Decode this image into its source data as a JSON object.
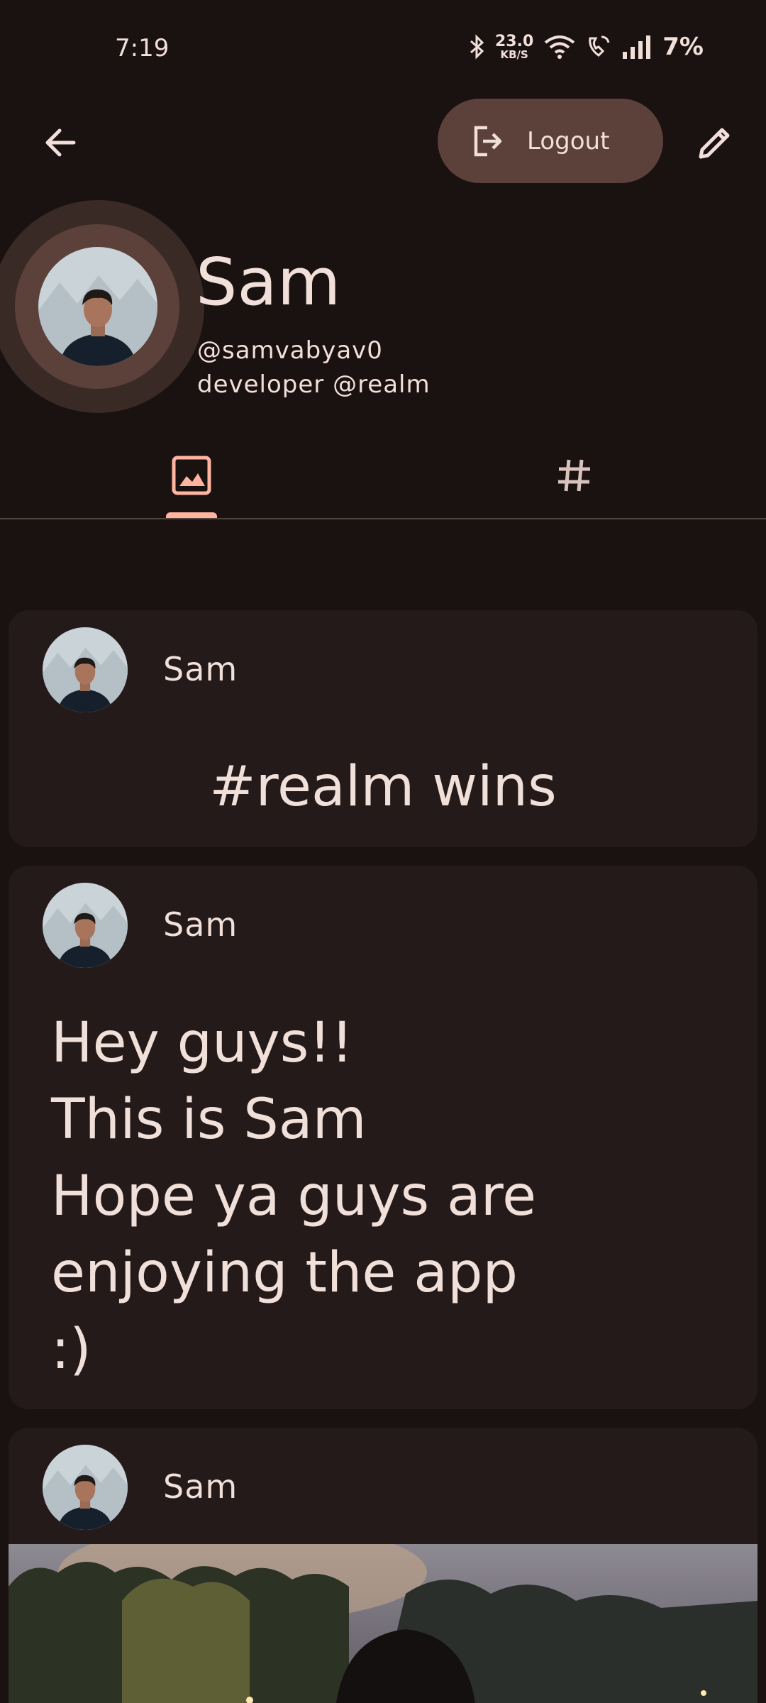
{
  "status_bar": {
    "time": "7:19",
    "net_speed_value": "23.0",
    "net_speed_unit": "KB/S",
    "battery": "7%"
  },
  "app_bar": {
    "logout_label": "Logout"
  },
  "profile": {
    "name": "Sam",
    "handle": "@samvabyav0",
    "bio": "developer @realm"
  },
  "tabs": [
    {
      "name": "photos",
      "icon": "image-icon",
      "selected": true
    },
    {
      "name": "tags",
      "icon": "hashtag-icon",
      "selected": false
    }
  ],
  "posts": [
    {
      "author": "Sam",
      "text": "#realm wins"
    },
    {
      "author": "Sam",
      "text": "Hey guys!!\nThis is Sam\nHope ya guys are\nenjoying the app\n:)"
    },
    {
      "author": "Sam",
      "text": ""
    }
  ],
  "colors": {
    "background": "#1a1111",
    "card": "#231a19",
    "accent": "#ffb4a0",
    "button": "#5c403a",
    "text": "#f1dfd9"
  }
}
